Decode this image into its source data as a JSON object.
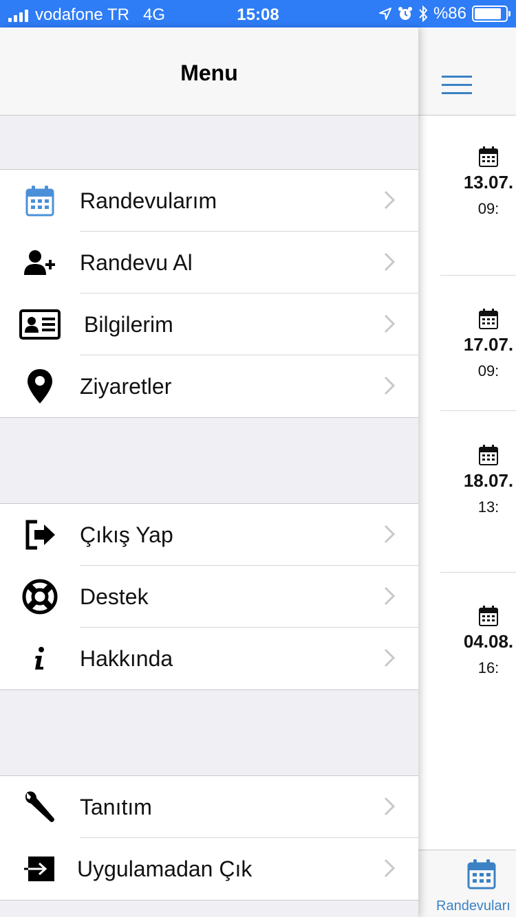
{
  "status_bar": {
    "carrier": "vodafone TR",
    "network": "4G",
    "time": "15:08",
    "battery_text": "%86",
    "battery_level": 0.86,
    "icons": [
      "signal-icon",
      "location-arrow-icon",
      "alarm-icon",
      "bluetooth-icon",
      "battery-icon"
    ]
  },
  "menu": {
    "title": "Menu",
    "groups": [
      {
        "items": [
          {
            "label": "Randevularım",
            "icon": "calendar-icon"
          },
          {
            "label": "Randevu Al",
            "icon": "user-plus-icon"
          },
          {
            "label": "Bilgilerim",
            "icon": "id-card-icon"
          },
          {
            "label": "Ziyaretler",
            "icon": "map-marker-icon"
          }
        ]
      },
      {
        "items": [
          {
            "label": "Çıkış Yap",
            "icon": "sign-out-icon"
          },
          {
            "label": "Destek",
            "icon": "life-ring-icon"
          },
          {
            "label": "Hakkında",
            "icon": "info-icon"
          }
        ]
      },
      {
        "items": [
          {
            "label": "Tanıtım",
            "icon": "wrench-icon"
          },
          {
            "label": "Uygulamadan Çık",
            "icon": "exit-app-icon"
          }
        ]
      }
    ]
  },
  "background_screen": {
    "appointments": [
      {
        "date": "13.07.",
        "time": "09:"
      },
      {
        "date": "17.07.",
        "time": "09:"
      },
      {
        "date": "18.07.",
        "time": "13:"
      },
      {
        "date": "04.08.",
        "time": "16:"
      }
    ],
    "tab_label": "Randevuları"
  },
  "colors": {
    "status_bar": "#2e7cf6",
    "accent": "#3b82c4",
    "calendar_icon": "#4a90d9",
    "grouped_background": "#efeff4"
  }
}
